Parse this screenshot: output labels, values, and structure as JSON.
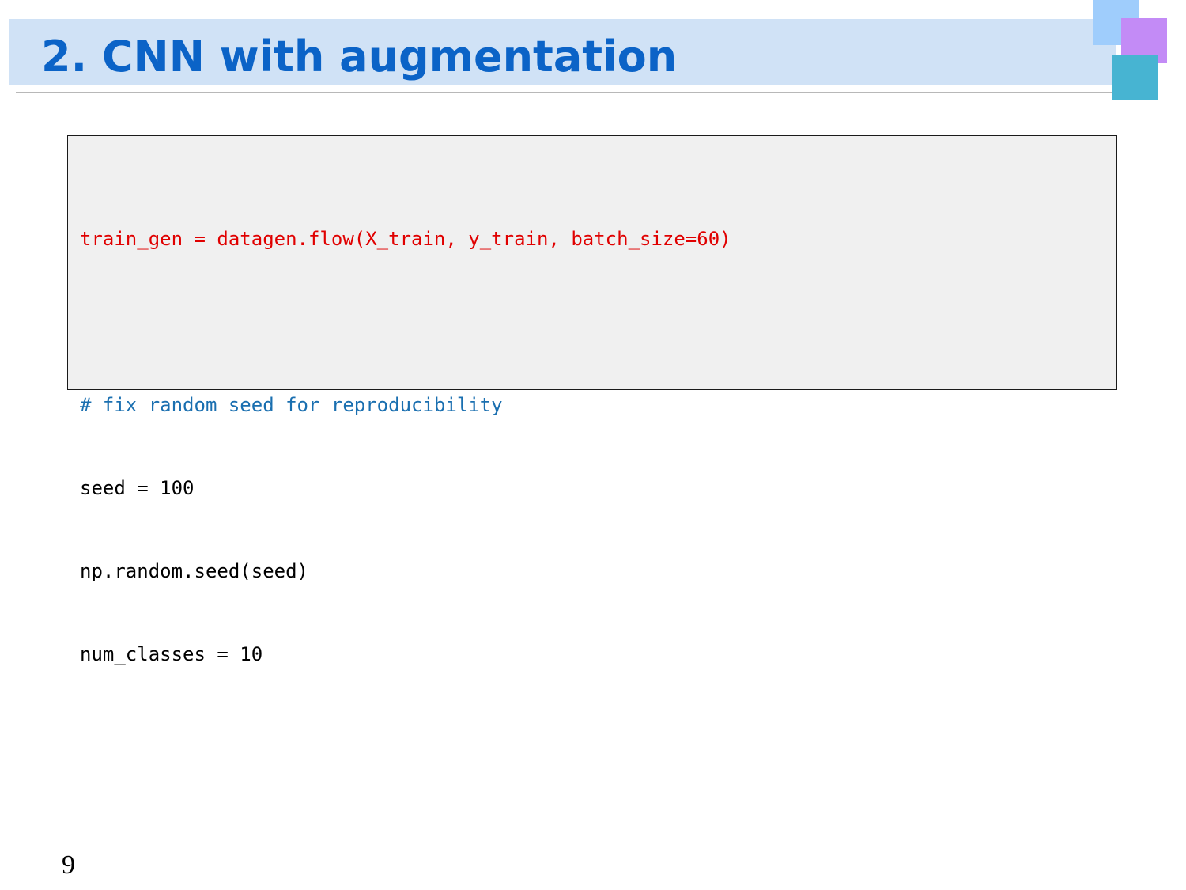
{
  "slide": {
    "title": "2. CNN with augmentation",
    "page_number": "9"
  },
  "code_block": {
    "lines": [
      {
        "text": "train_gen = datagen.flow(X_train, y_train, batch_size=60)",
        "style": "highlight-red"
      },
      {
        "text": "",
        "style": "blank"
      },
      {
        "text": "# fix random seed for reproducibility",
        "style": "comment"
      },
      {
        "text": "seed = 100",
        "style": "plain"
      },
      {
        "text": "np.random.seed(seed)",
        "style": "plain"
      },
      {
        "text": "num_classes = 10",
        "style": "plain"
      }
    ]
  },
  "colors": {
    "title_text": "#0b63c7",
    "title_bar": "#d0e2f6",
    "code_highlight": "#e00000",
    "code_comment": "#1a6fb0",
    "code_background": "#f0f0f0",
    "deco_square_blue": "#9fcdfc",
    "deco_square_purple": "#c38bf6",
    "deco_square_teal": "#47b4d2"
  }
}
